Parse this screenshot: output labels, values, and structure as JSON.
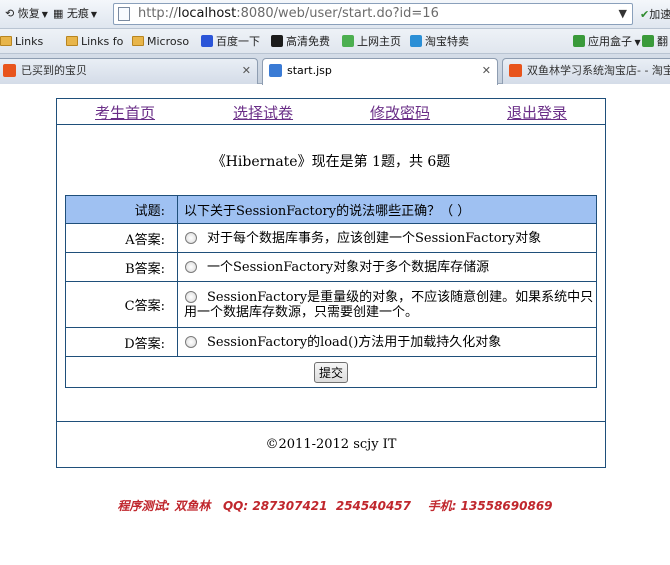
{
  "browser": {
    "nav": {
      "restore_label": "恢复",
      "no_trace_label": "无痕",
      "accelerate_label": "加速"
    },
    "address": {
      "url_prefix": "http://",
      "url_host": "localhost",
      "url_rest": ":8080/web/user/start.do?id=16"
    },
    "favorites": [
      {
        "label": "Links"
      },
      {
        "label": "Links fo"
      },
      {
        "label": "Microso"
      },
      {
        "label": "百度一下"
      },
      {
        "label": "高清免费"
      },
      {
        "label": "上网主页"
      },
      {
        "label": "淘宝特卖"
      },
      {
        "label": "应用盒子"
      },
      {
        "label": "翻"
      }
    ],
    "tabs": [
      {
        "label": "已买到的宝贝"
      },
      {
        "label": "start.jsp"
      },
      {
        "label": "双鱼林学习系统淘宝店- - 淘宝"
      }
    ],
    "colors": {
      "tab_icon_taobao": "#e8541c",
      "tab_icon_page": "#3a7bd5"
    }
  },
  "page": {
    "nav_links": [
      "考生首页",
      "选择试卷",
      "修改密码",
      "退出登录"
    ],
    "progress_text": "《Hibernate》现在是第 1题，共 6题",
    "question": {
      "label": "试题:",
      "text": "以下关于SessionFactory的说法哪些正确？（  ）"
    },
    "options": [
      {
        "label": "A答案:",
        "text": "对于每个数据库事务，应该创建一个SessionFactory对象"
      },
      {
        "label": "B答案:",
        "text": "一个SessionFactory对象对于多个数据库存储源"
      },
      {
        "label": "C答案:",
        "text": "SessionFactory是重量级的对象，不应该随意创建。如果系统中只用一个数据库存数源，只需要创建一个。"
      },
      {
        "label": "D答案:",
        "text": "SessionFactory的load()方法用于加载持久化对象"
      }
    ],
    "submit_label": "提交",
    "copyright": "©2011-2012 scjy IT",
    "credit": "程序测试: 双鱼林   QQ: 287307421  254540457    手机: 13558690869",
    "colors": {
      "header_row": "#9fc1f2",
      "border": "#1f4f7a",
      "link": "#6a2e87",
      "credit": "#c0272d"
    }
  }
}
